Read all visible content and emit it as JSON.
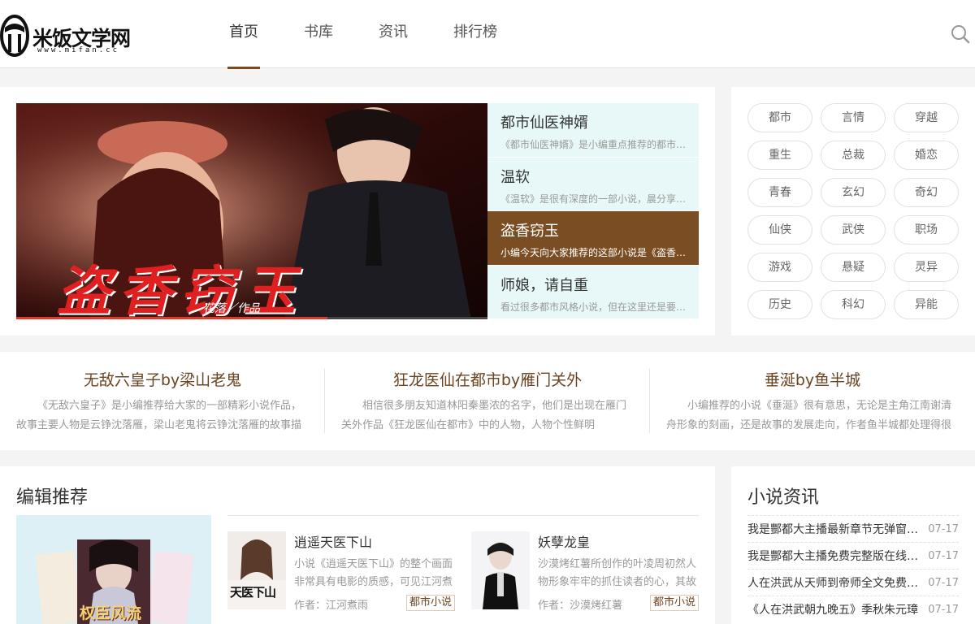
{
  "header": {
    "logo_text": "米饭文学网",
    "logo_sub": "www.mifan.cc",
    "nav": [
      "首页",
      "书库",
      "资讯",
      "排行榜"
    ]
  },
  "banner": {
    "cover_text": "盗香窃玉",
    "cover_author": "花落／作品",
    "progress": 0.66,
    "items": [
      {
        "title": "都市仙医神婿",
        "desc": "《都市仙医神婿》是小编重点推荐的都市小说"
      },
      {
        "title": "温软",
        "desc": "《温软》是很有深度的一部小说，晨分享给大家"
      },
      {
        "title": "盗香窃玉",
        "desc": "小编今天向大家推荐的这部小说是《盗香窃玉》"
      },
      {
        "title": "师娘，请自重",
        "desc": "看过很多都市风格小说，但在这里还是要推荐"
      }
    ]
  },
  "tags": [
    "都市",
    "言情",
    "穿越",
    "重生",
    "总裁",
    "婚恋",
    "青春",
    "玄幻",
    "奇幻",
    "仙侠",
    "武侠",
    "职场",
    "游戏",
    "悬疑",
    "灵异",
    "历史",
    "科幻",
    "异能"
  ],
  "featured": [
    {
      "title": "无敌六皇子by梁山老鬼",
      "desc": "《无敌六皇子》是小编推荐给大家的一部精彩小说作品，故事主要人物是云铮沈落雁，梁山老鬼将云铮沈落雁的故事描绘得十分精彩"
    },
    {
      "title": "狂龙医仙在都市by雁门关外",
      "desc": "相信很多朋友知道林阳秦墨浓的名字，他们是出现在雁门关外作品《狂龙医仙在都市》中的人物，人物个性鲜明"
    },
    {
      "title": "垂涎by鱼半城",
      "desc": "小编推荐的小说《垂涎》很有意思，无论是主角江南谢清舟形象的刻画，还是故事的发展走向，作者鱼半城都处理得很好"
    }
  ],
  "editor": {
    "title": "编辑推荐",
    "cover_text": "权臣风流",
    "books": [
      {
        "title": "逍遥天医下山",
        "desc": "小说《逍遥天医下山》的整个画面非常具有电影的质感，可见江河煮雨的功力",
        "author": "作者：江河煮雨",
        "tag": "都市小说",
        "cover_text": "天医下山"
      },
      {
        "title": "妖孽龙皇",
        "desc": "沙漠烤红薯所创作的叶凌周初然人物形象牢牢的抓住读者的心，其故事精彩",
        "author": "作者：沙漠烤红薯",
        "tag": "都市小说"
      }
    ]
  },
  "news": {
    "title": "小说资讯",
    "items": [
      {
        "title": "我是酆都大主播最新章节无弹窗阅读",
        "date": "07-17"
      },
      {
        "title": "我是酆都大主播免费完整版在线阅读",
        "date": "07-17"
      },
      {
        "title": "人在洪武从天师到帝师全文免费阅读",
        "date": "07-17"
      },
      {
        "title": "《人在洪武朝九晚五》季秋朱元璋",
        "date": "07-17"
      }
    ]
  },
  "colors": {
    "accent": "#7a4e22",
    "slide_bg": "#e8f8f8",
    "progress": "#e03a2a"
  }
}
